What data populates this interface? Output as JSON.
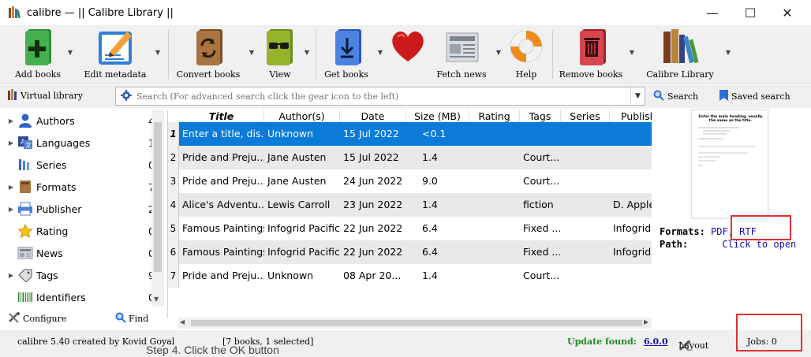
{
  "window": {
    "title": "calibre — || Calibre Library ||",
    "minimize": "—",
    "maximize": "☐",
    "close": "✕"
  },
  "toolbar": {
    "add_books": "Add books",
    "edit_metadata": "Edit metadata",
    "convert_books": "Convert books",
    "view": "View",
    "get_books": "Get books",
    "fetch_news": "Fetch news",
    "help": "Help",
    "remove_books": "Remove books",
    "calibre_library": "Calibre Library",
    "dropdown_glyph": "▼",
    "colors": {
      "add": "#3aa845",
      "edit": "#2f7fd6",
      "convert": "#9b6a3c",
      "view": "#8cab2a",
      "get": "#3b71d6",
      "remove": "#c9303a",
      "heart": "#cc1a1a"
    }
  },
  "search": {
    "virtual_library": "Virtual library",
    "placeholder": "Search (For advanced search click the gear icon to the left)",
    "search_label": "Search",
    "saved_search_label": "Saved search"
  },
  "tag_browser": {
    "items": [
      {
        "label": "Authors",
        "count": "4",
        "expandable": true,
        "icon": "person-icon"
      },
      {
        "label": "Languages",
        "count": "1",
        "expandable": true,
        "icon": "language-icon"
      },
      {
        "label": "Series",
        "count": "0",
        "expandable": false,
        "icon": "series-icon"
      },
      {
        "label": "Formats",
        "count": "7",
        "expandable": true,
        "icon": "book-icon"
      },
      {
        "label": "Publisher",
        "count": "2",
        "expandable": true,
        "icon": "printer-icon"
      },
      {
        "label": "Rating",
        "count": "0",
        "expandable": false,
        "icon": "star-icon"
      },
      {
        "label": "News",
        "count": "0",
        "expandable": false,
        "icon": "newspaper-icon"
      },
      {
        "label": "Tags",
        "count": "9",
        "expandable": true,
        "icon": "tag-icon"
      },
      {
        "label": "Identifiers",
        "count": "0",
        "expandable": false,
        "icon": "barcode-icon"
      }
    ],
    "expand_glyph": "▶",
    "configure": "Configure",
    "find": "Find"
  },
  "book_list": {
    "columns": [
      "Title",
      "Author(s)",
      "Date",
      "Size (MB)",
      "Rating",
      "Tags",
      "Series",
      "Publish"
    ],
    "rows": [
      {
        "num": "1",
        "title": "Enter a title, dis...",
        "author": "Unknown",
        "date": "15 Jul 2022",
        "size": "<0.1",
        "tags": "",
        "series": "",
        "publisher": "",
        "selected": true
      },
      {
        "num": "2",
        "title": "Pride and Preju...",
        "author": "Jane Austen",
        "date": "15 Jul 2022",
        "size": "1.4",
        "tags": "Court...",
        "series": "",
        "publisher": ""
      },
      {
        "num": "3",
        "title": "Pride and Preju...",
        "author": "Jane Austen",
        "date": "24 Jun 2022",
        "size": "9.0",
        "tags": "Court...",
        "series": "",
        "publisher": ""
      },
      {
        "num": "4",
        "title": "Alice's Adventu...",
        "author": "Lewis Carroll",
        "date": "23 Jun 2022",
        "size": "1.4",
        "tags": "fiction",
        "series": "",
        "publisher": "D. Applet"
      },
      {
        "num": "5",
        "title": "Famous Paintings",
        "author": "Infogrid Pacific",
        "date": "22 Jun 2022",
        "size": "6.4",
        "tags": "Fixed ...",
        "series": "",
        "publisher": "Infogrid"
      },
      {
        "num": "6",
        "title": "Famous Paintings",
        "author": "Infogrid Pacific",
        "date": "22 Jun 2022",
        "size": "6.4",
        "tags": "Fixed ...",
        "series": "",
        "publisher": "Infogrid"
      },
      {
        "num": "7",
        "title": "Pride and Preju...",
        "author": "Unknown",
        "date": "08 Apr 20...",
        "size": "1.4",
        "tags": "Court...",
        "series": "",
        "publisher": ""
      }
    ],
    "selected_color": "#0a7bd8",
    "alt_row_color": "#e9e9e9"
  },
  "details": {
    "formats_label": "Formats:",
    "format_pdf": "PDF,",
    "format_rtf": "RTF",
    "path_label": "Path:",
    "path_link": "Click to open",
    "cover_heading": "Enter the main heading, usually the same as the title."
  },
  "status": {
    "version": "calibre 5.40 created by Kovid Goyal",
    "books": "[7 books, 1 selected]",
    "update_label": "Update found:",
    "update_version": "6.0.0",
    "layout": "Layout",
    "jobs": "Jobs: 0"
  },
  "background_text": "Step 4. Click the OK button"
}
